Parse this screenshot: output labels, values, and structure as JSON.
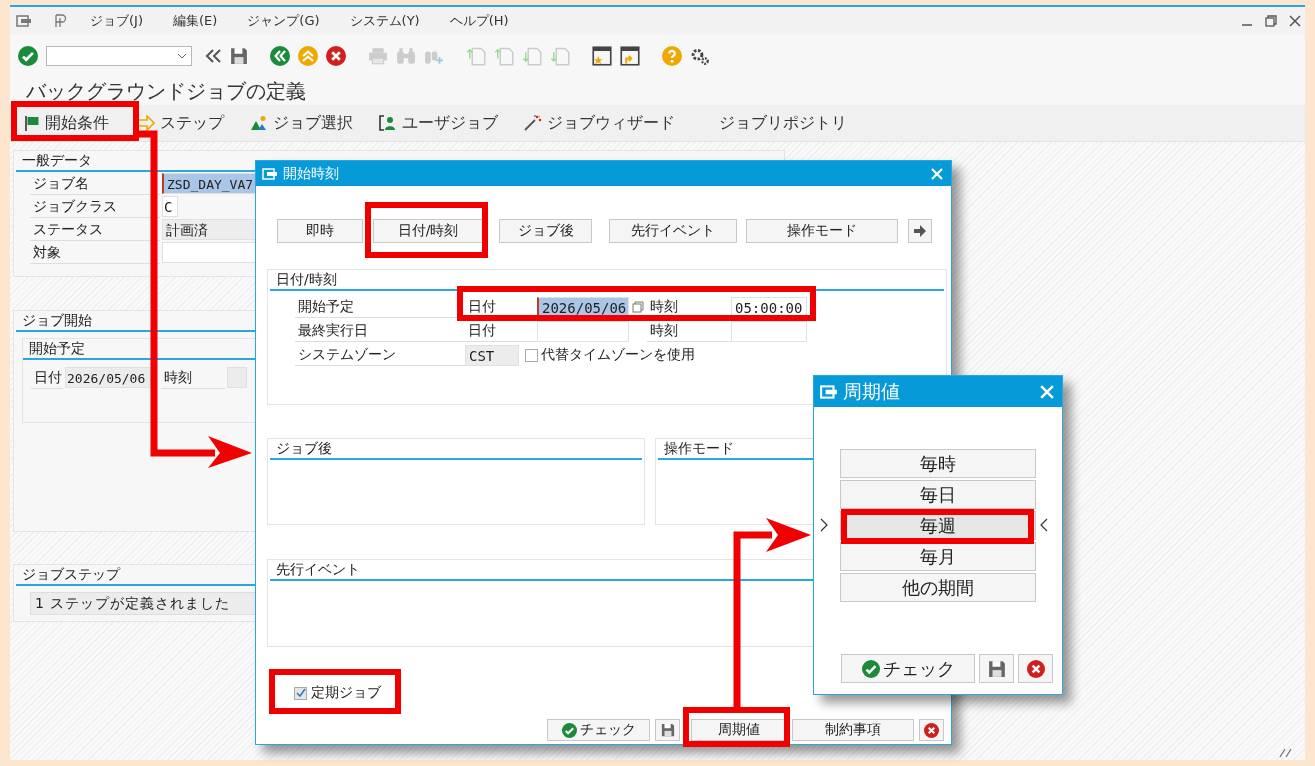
{
  "menu_bar": {
    "items": [
      "ジョブ(J)",
      "編集(E)",
      "ジャンプ(G)",
      "システム(Y)",
      "ヘルプ(H)"
    ]
  },
  "screen_title": "バックグラウンドジョブの定義",
  "app_toolbar": {
    "items": [
      {
        "kind": "flag",
        "label": "開始条件"
      },
      {
        "kind": "step",
        "label": "ステップ"
      },
      {
        "kind": "select",
        "label": "ジョブ選択"
      },
      {
        "kind": "user",
        "label": "ユーザジョブ"
      },
      {
        "kind": "wizard",
        "label": "ジョブウィザード"
      },
      {
        "kind": "plain",
        "label": "ジョブリポジトリ"
      }
    ]
  },
  "general_data": {
    "title": "一般データ",
    "fields": [
      {
        "label": "ジョブ名",
        "value": "ZSD_DAY_VA7",
        "focused": true
      },
      {
        "label": "ジョブクラス",
        "value": "C",
        "focused": false
      },
      {
        "label": "ステータス",
        "value": "計画済",
        "focused": false
      },
      {
        "label": "対象",
        "focused": false
      }
    ]
  },
  "job_start": {
    "title": "ジョブ開始",
    "subgroup": {
      "title": "開始予定",
      "date_label": "日付",
      "date": "2026/05/06",
      "time_label": "時刻"
    }
  },
  "job_steps": {
    "title": "ジョブステップ",
    "message": "1 ステップが定義されました"
  },
  "start_time_dialog": {
    "title": "開始時刻",
    "buttons": [
      "即時",
      "日付/時刻",
      "ジョブ後",
      "先行イベント",
      "操作モード"
    ],
    "date_time_group": {
      "title": "日付/時刻",
      "rows": [
        {
          "label": "開始予定",
          "date_label": "日付",
          "date": "2026/05/06",
          "time_label": "時刻",
          "time": "05:00:00",
          "focused": true
        },
        {
          "label": "最終実行日",
          "date_label": "日付",
          "time_label": "時刻",
          "focused": false
        }
      ],
      "zone": {
        "label": "システムゾーン",
        "value": "CST",
        "checkbox_label": "代替タイムゾーンを使用",
        "checked": false
      }
    },
    "groups": [
      "ジョブ後",
      "操作モード",
      "先行イベント"
    ],
    "periodic_job": {
      "label": "定期ジョブ",
      "checked": true
    },
    "footer_buttons": [
      {
        "kind": "check",
        "label": "チェック"
      },
      {
        "kind": "save"
      },
      {
        "kind": "text",
        "label": "周期値"
      },
      {
        "kind": "text",
        "label": "制約事項"
      },
      {
        "kind": "cancel"
      }
    ]
  },
  "period_dialog": {
    "title": "周期値",
    "options": [
      {
        "label": "毎時",
        "selected": false
      },
      {
        "label": "毎日",
        "selected": false
      },
      {
        "label": "毎週",
        "selected": true
      },
      {
        "label": "毎月",
        "selected": false
      },
      {
        "label": "他の期間",
        "selected": false
      }
    ],
    "footer_buttons": [
      {
        "kind": "check",
        "label": "チェック"
      },
      {
        "kind": "save"
      },
      {
        "kind": "cancel"
      }
    ]
  }
}
